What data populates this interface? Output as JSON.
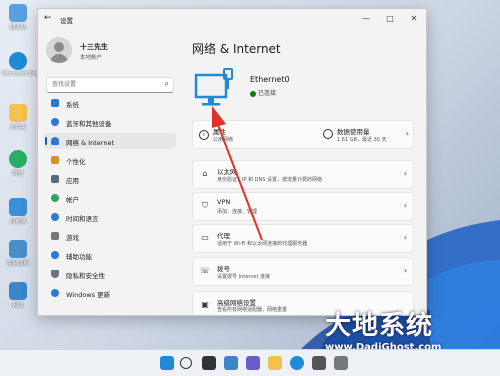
{
  "desktop": {
    "icons": [
      {
        "label": "回收站",
        "icon": "recycle-bin-icon",
        "color": "#5aa0e0"
      },
      {
        "label": "Microsoft Edge",
        "icon": "edge-icon",
        "color": "#1f8ad6"
      },
      {
        "label": "文件夹",
        "icon": "folder-icon",
        "color": "#f2c14e"
      },
      {
        "label": "微信",
        "icon": "wechat-icon",
        "color": "#2aae67"
      },
      {
        "label": "此电脑",
        "icon": "computer-icon",
        "color": "#3b8ed8"
      },
      {
        "label": "控制面板",
        "icon": "control-panel-icon",
        "color": "#4a90c8"
      },
      {
        "label": "网络",
        "icon": "network-icon",
        "color": "#3a86c9"
      }
    ]
  },
  "window": {
    "title": "设置",
    "controls": [
      "—",
      "□",
      "✕"
    ]
  },
  "user": {
    "name": "十三先生",
    "type": "本地帐户"
  },
  "search": {
    "placeholder": "查找设置"
  },
  "nav": [
    {
      "label": "系统",
      "icon": "system-icon",
      "color": "#2b79d6"
    },
    {
      "label": "蓝牙和其他设备",
      "icon": "bluetooth-icon",
      "color": "#2b79d6"
    },
    {
      "label": "网络 & Internet",
      "icon": "wifi-icon",
      "color": "#2b79d6",
      "selected": true
    },
    {
      "label": "个性化",
      "icon": "brush-icon",
      "color": "#e08a2a"
    },
    {
      "label": "应用",
      "icon": "apps-icon",
      "color": "#5a6b7d"
    },
    {
      "label": "帐户",
      "icon": "account-icon",
      "color": "#2fa56a"
    },
    {
      "label": "时间和语言",
      "icon": "globe-clock-icon",
      "color": "#2b79d6"
    },
    {
      "label": "游戏",
      "icon": "gamepad-icon",
      "color": "#777777"
    },
    {
      "label": "辅助功能",
      "icon": "accessibility-icon",
      "color": "#2b79d6"
    },
    {
      "label": "隐私和安全性",
      "icon": "shield-icon",
      "color": "#6b7480"
    },
    {
      "label": "Windows 更新",
      "icon": "update-icon",
      "color": "#2b79d6"
    }
  ],
  "main": {
    "title": "网络 & Internet",
    "ethernet": {
      "name": "Ethernet0",
      "status": "已连接"
    },
    "properties": {
      "title": "属性",
      "detail": "公用网络"
    },
    "data_usage": {
      "title": "数据使用量",
      "detail": "1.61 GB，最近 30 天"
    },
    "cards": [
      {
        "title": "以太网",
        "detail": "身份验证，IP 和 DNS 设置，按流量计费的网络",
        "icon": "ethernet-icon"
      },
      {
        "title": "VPN",
        "detail": "添加、连接、管理",
        "icon": "vpn-shield-icon"
      },
      {
        "title": "代理",
        "detail": "适用于 Wi-Fi 和以太网连接的代理服务器",
        "icon": "proxy-icon"
      },
      {
        "title": "拨号",
        "detail": "设置拨号 Internet 连接",
        "icon": "dialup-icon"
      },
      {
        "title": "高级网络设置",
        "detail": "查看所有网络适配器，网络重置",
        "icon": "advanced-network-icon"
      }
    ]
  },
  "watermark": {
    "big": "大地系统",
    "small": "www.DadiGhost.com"
  },
  "colors": {
    "accent": "#0067c0",
    "monitor": "#1f8ad6",
    "annotation_arrow": "#e0312b",
    "status_green": "#0f7b0f"
  }
}
